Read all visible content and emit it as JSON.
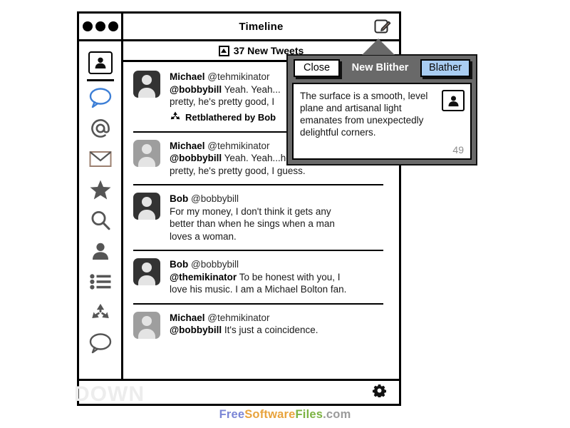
{
  "window": {
    "title": "Timeline",
    "compose_icon": "compose-pencil-icon",
    "traffic_dots": 3
  },
  "newtweets": {
    "label": "37 New Tweets",
    "icon": "triangle-up-boxed-icon"
  },
  "sidebar": {
    "items": [
      {
        "name": "profile-avatar",
        "icon": "person-boxed-icon"
      },
      {
        "name": "divider",
        "icon": "divider-line"
      },
      {
        "name": "blathers",
        "icon": "speech-bubble-blue-icon"
      },
      {
        "name": "mentions",
        "icon": "at-sign-icon"
      },
      {
        "name": "messages",
        "icon": "envelope-icon"
      },
      {
        "name": "favorites",
        "icon": "star-icon"
      },
      {
        "name": "search",
        "icon": "magnifier-icon"
      },
      {
        "name": "people",
        "icon": "person-silhouette-icon"
      },
      {
        "name": "lists",
        "icon": "list-icon"
      },
      {
        "name": "retblathers",
        "icon": "recycle-icon"
      },
      {
        "name": "comments",
        "icon": "speech-bubble-gray-icon"
      }
    ]
  },
  "tweets": [
    {
      "avatar": "dark",
      "name": "Michael",
      "handle": "@tehmikinator",
      "mention": "@bobbybill",
      "lines": [
        " Yeah. Yeah...",
        "pretty, he's pretty good, I"
      ],
      "retblather": "Retblathered by Bob",
      "retblather_icon": "recycle-icon"
    },
    {
      "avatar": "gray",
      "name": "Michael",
      "handle": "@tehmikinator",
      "mention": "@bobbybill",
      "lines": [
        " Yeah. Yeah...he, he, he's",
        "pretty, he's pretty good, I guess."
      ],
      "retblather": null,
      "retblather_icon": null
    },
    {
      "avatar": "dark",
      "name": "Bob",
      "handle": "@bobbybill",
      "mention": null,
      "lines": [
        "For my money, I don't think it gets any",
        "better than when he sings when a man",
        "loves a woman."
      ],
      "retblather": null,
      "retblather_icon": null
    },
    {
      "avatar": "dark",
      "name": "Bob",
      "handle": "@bobbybill",
      "mention": "@themikinator",
      "lines": [
        " To be honest with you, I",
        "love his music. I am a Michael Bolton fan."
      ],
      "retblather": null,
      "retblather_icon": null
    },
    {
      "avatar": "gray",
      "name": "Michael",
      "handle": "@tehmikinator",
      "mention": "@bobbybill",
      "lines": [
        " It's just a coincidence."
      ],
      "retblather": null,
      "retblather_icon": null
    }
  ],
  "popup": {
    "close_label": "Close",
    "title": "New Blither",
    "submit_label": "Blather",
    "text": "The surface is a smooth, level plane and artisanal light emanates from unexpectedly delightful corners.",
    "char_count": "49",
    "avatar_icon": "person-boxed-icon",
    "accent_color": "#a9cdf2",
    "header_color": "#696969"
  },
  "footer": {
    "settings_icon": "gear-icon"
  },
  "watermark": {
    "part1": "Free",
    "part2": "Software",
    "part3": "Files",
    "part4": ".com",
    "color1": "#7b86d6",
    "color2": "#e8a33d",
    "color3": "#7cb342",
    "color4": "#9b9b9b"
  },
  "ghost_text": "DOWN"
}
